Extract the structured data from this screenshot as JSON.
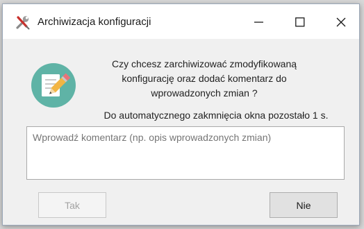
{
  "window": {
    "title": "Archiwizacja konfiguracji",
    "controls": {
      "minimize_icon": "minimize-icon",
      "maximize_icon": "maximize-icon",
      "close_icon": "close-icon"
    }
  },
  "message": {
    "lines": [
      "Czy chcesz zarchiwizować zmodyfikowaną",
      "konfigurację oraz dodać komentarz do",
      "wprowadzonych zmian ?"
    ],
    "countdown": "Do automatycznego zakmnięcia okna pozostało 1 s.",
    "icon": "edit-note-icon"
  },
  "comment": {
    "value": "",
    "placeholder": "Wprowadź komentarz (np. opis wprowadzonych zmian)"
  },
  "buttons": {
    "yes_label": "Tak",
    "yes_disabled": true,
    "no_label": "Nie"
  },
  "colors": {
    "icon_circle": "#5fb3a6",
    "window_bg": "#f0f0f0",
    "titlebar_bg": "#ffffff"
  }
}
